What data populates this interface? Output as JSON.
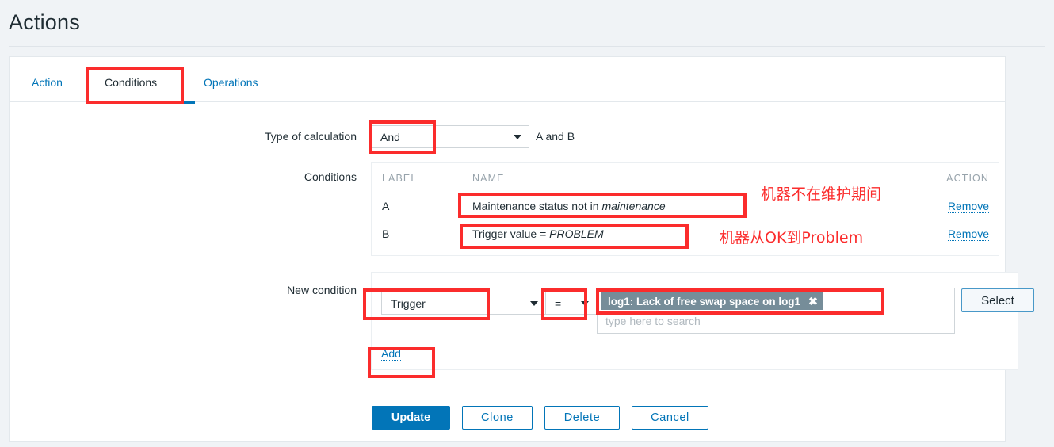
{
  "header": {
    "title": "Actions"
  },
  "tabs": [
    {
      "label": "Action",
      "active": false
    },
    {
      "label": "Conditions",
      "active": true
    },
    {
      "label": "Operations",
      "active": false
    }
  ],
  "form": {
    "type_of_calculation": {
      "label": "Type of calculation",
      "value": "And",
      "formula": "A and B"
    },
    "conditions": {
      "label": "Conditions",
      "columns": [
        "LABEL",
        "NAME",
        "ACTION"
      ],
      "rows": [
        {
          "label": "A",
          "name": "Maintenance status not in ",
          "name_italic": "maintenance",
          "action": "Remove"
        },
        {
          "label": "B",
          "name": "Trigger value = ",
          "name_italic": "PROBLEM",
          "action": "Remove"
        }
      ]
    },
    "new_condition": {
      "label": "New condition",
      "type_value": "Trigger",
      "operator_value": "=",
      "multiselect": {
        "tag": "log1: Lack of free swap space on log1",
        "tag_remove": "✖",
        "placeholder": "type here to search"
      },
      "select_button": "Select",
      "add_link": "Add"
    }
  },
  "footer": {
    "buttons": [
      {
        "label": "Update",
        "style": "primary"
      },
      {
        "label": "Clone",
        "style": "secondary"
      },
      {
        "label": "Delete",
        "style": "secondary"
      },
      {
        "label": "Cancel",
        "style": "secondary"
      }
    ]
  },
  "annotations": {
    "note_a": "机器不在维护期间",
    "note_b": "机器从OK到Problem"
  },
  "colors": {
    "accent": "#0275b8",
    "annotation": "#fb2c2c",
    "tag_bg": "#768d99",
    "page_bg": "#f0f3f6"
  }
}
